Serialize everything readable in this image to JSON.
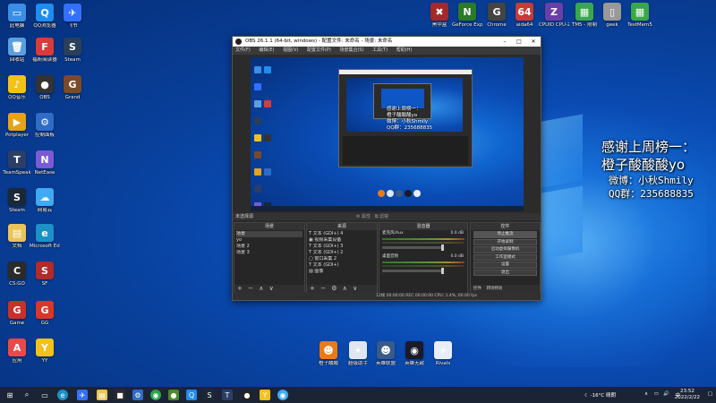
{
  "desktop": {
    "left_icons": [
      {
        "label": "此电脑",
        "color": "#3a8ee6",
        "glyph": "▭"
      },
      {
        "label": "QQ浏览器",
        "color": "#1f8cf0",
        "glyph": "Q"
      },
      {
        "label": "飞书",
        "color": "#3370ff",
        "glyph": "✈"
      },
      {
        "label": "回收站",
        "color": "#5aa0e0",
        "glyph": "🗑"
      },
      {
        "label": "福昕阅读器",
        "color": "#d93b3b",
        "glyph": "F"
      },
      {
        "label": "Steam",
        "color": "#2a3f5a",
        "glyph": "S"
      },
      {
        "label": "QQ音乐",
        "color": "#f2c21b",
        "glyph": "♪"
      },
      {
        "label": "OBS",
        "color": "#333333",
        "glyph": "●"
      },
      {
        "label": "Grand",
        "color": "#7a4a2a",
        "glyph": "G"
      },
      {
        "label": "Potplayer",
        "color": "#e6a21a",
        "glyph": "▶"
      },
      {
        "label": "控制面板",
        "color": "#2f6cc8",
        "glyph": "⚙"
      },
      {
        "label": "TeamSpeak",
        "color": "#2b3e66",
        "glyph": "T"
      },
      {
        "label": "NetEase",
        "color": "#7a5bd6",
        "glyph": "N"
      },
      {
        "label": "Steam",
        "color": "#1b2838",
        "glyph": "S"
      },
      {
        "label": "网易云",
        "color": "#3fa9f5",
        "glyph": "☁"
      },
      {
        "label": "文档",
        "color": "#e8c45a",
        "glyph": "▤"
      },
      {
        "label": "Microsoft Edge",
        "color": "#1e90c8",
        "glyph": "e"
      },
      {
        "label": "CS:GO",
        "color": "#2b2b2b",
        "glyph": "C"
      },
      {
        "label": "SF",
        "color": "#b22a2a",
        "glyph": "S"
      },
      {
        "label": "Game",
        "color": "#c8302a",
        "glyph": "G"
      },
      {
        "label": "GG",
        "color": "#d9372a",
        "glyph": "G"
      },
      {
        "label": "应用",
        "color": "#e84a4a",
        "glyph": "A"
      },
      {
        "label": "YY",
        "color": "#f2c21b",
        "glyph": "Y"
      }
    ],
    "top_icons": [
      {
        "label": "黑中盒",
        "color": "#a82828",
        "glyph": "✖"
      },
      {
        "label": "GeForce Experience",
        "color": "#2a7a2a",
        "glyph": "N"
      },
      {
        "label": "Chrome",
        "color": "#444444",
        "glyph": "G"
      },
      {
        "label": "aida64",
        "color": "#c83a3a",
        "glyph": "64"
      },
      {
        "label": "CPUID CPU-Z",
        "color": "#6a3fa8",
        "glyph": "Z"
      },
      {
        "label": "TM5 - 限制",
        "color": "#3aa84a",
        "glyph": "▦"
      },
      {
        "label": "geek",
        "color": "#999999",
        "glyph": "▯"
      },
      {
        "label": "TestMem5",
        "color": "#3aa84a",
        "glyph": "▦"
      }
    ],
    "bottom_icons": [
      {
        "label": "橙子酸酸",
        "color": "#e87a1a",
        "glyph": "☻"
      },
      {
        "label": "超级助手",
        "color": "#dfe6f0",
        "glyph": "✦"
      },
      {
        "label": "英雄联盟",
        "color": "#3a5a8a",
        "glyph": "☻"
      },
      {
        "label": "英雄无敌",
        "color": "#1a1a2a",
        "glyph": "◉"
      },
      {
        "label": "Rivals",
        "color": "#e8eef8",
        "glyph": "✈"
      }
    ]
  },
  "overlay": {
    "line1": "感谢上周榜一：",
    "line2": "橙子酸酸酸yo",
    "line3": "微博：小秋Shmily",
    "line4": "QQ群：235688835"
  },
  "obs": {
    "title": "OBS 26.1.1 (64-bit, windows) - 配置文件: 未命名 - 场景: 未命名",
    "menu": [
      "文件(F)",
      "编辑(E)",
      "视图(V)",
      "配置文件(P)",
      "场景集合(S)",
      "工具(T)",
      "帮助(H)"
    ],
    "preview_overlay": [
      "感谢上周榜一：",
      "橙子酸酸酸yo",
      "微博：小秋Shmily",
      "QQ群：235688835"
    ],
    "status_left": "未选择源",
    "props_label": "属性",
    "filters_label": "滤镜",
    "scenes": {
      "header": "场景",
      "items": [
        "场景",
        "yo",
        "场景 2",
        "场景 3"
      ]
    },
    "sources": {
      "header": "来源",
      "items": [
        "文本 (GDI+) 4",
        "视频采集设备",
        "文本 (GDI+) 3",
        "文本 (GDI+) 2",
        "窗口采集 2",
        "文本 (GDI+)",
        "图像"
      ]
    },
    "mixer": {
      "header": "混音器",
      "channels": [
        {
          "name": "麦克风/Aux",
          "db": "0.0 dB"
        },
        {
          "name": "桌面音频",
          "db": "0.0 dB"
        }
      ]
    },
    "controls": {
      "header": "控件",
      "buttons": [
        "停止推流",
        "开始录制",
        "启动虚拟摄像机",
        "工作室模式",
        "设置",
        "退出"
      ],
      "tabs": [
        "控件",
        "转场特效"
      ]
    },
    "bottom_status": "12帧 00:00:00   REC 00:00:00   CPU: 1.4%, 60.00 fps"
  },
  "taskbar": {
    "temperature": "-16°C 晴朗",
    "time": "23:52",
    "date": "2022/2/22"
  }
}
